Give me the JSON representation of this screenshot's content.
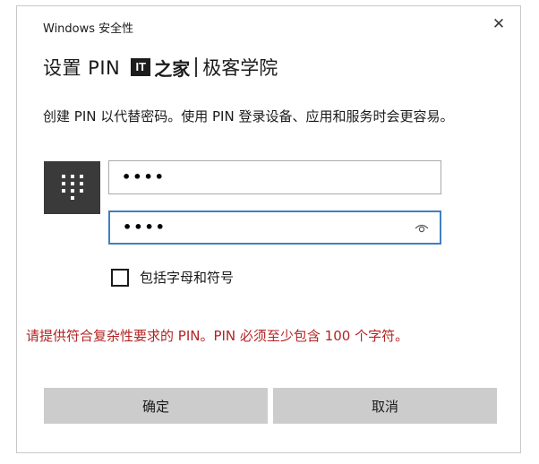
{
  "window": {
    "title": "Windows 安全性",
    "close_glyph": "✕"
  },
  "dialog": {
    "heading": "设置 PIN",
    "watermark": {
      "logo_text": "IT",
      "glyph": "之家",
      "text": "极客学院"
    },
    "description": "创建 PIN 以代替密码。使用 PIN 登录设备、应用和服务时会更容易。"
  },
  "pin": {
    "keypad_icon": "keypad-icon",
    "new_pin_value": "••••",
    "confirm_pin_value": "••••",
    "reveal_icon": "eye-icon"
  },
  "options": {
    "include_letters_label": "包括字母和符号",
    "include_letters_checked": false
  },
  "error": {
    "message": "请提供符合复杂性要求的 PIN。PIN 必须至少包含 100 个字符。"
  },
  "buttons": {
    "ok_label": "确定",
    "cancel_label": "取消"
  },
  "colors": {
    "error": "#b32424",
    "focus_border": "#3f7fc1",
    "button_bg": "#cccccc",
    "keypad_bg": "#3a3a3a"
  }
}
